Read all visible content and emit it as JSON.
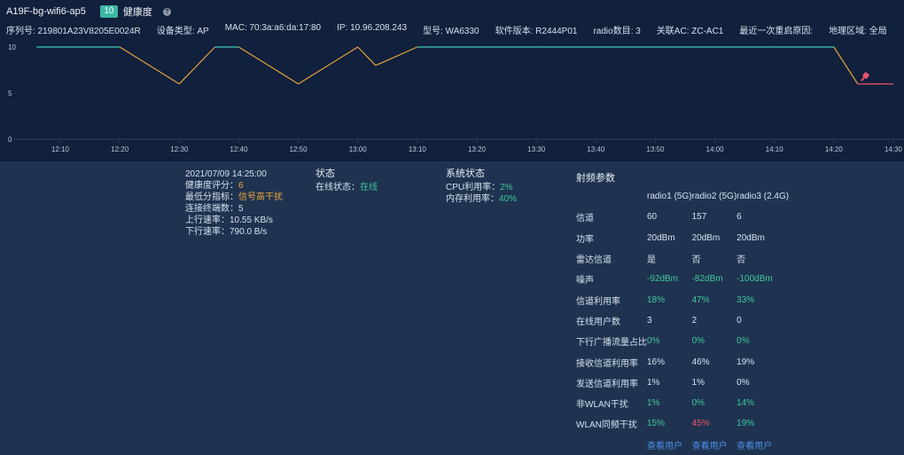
{
  "header": {
    "device_name": "A19F-bg-wifi6-ap5",
    "health_score": "10",
    "health_label": "健康度",
    "help_glyph": "?"
  },
  "meta": [
    "序列号: 219801A23V8205E0024R",
    "设备类型: AP",
    "MAC: 70:3a:a6:da:17:80",
    "IP: 10.96.208.243",
    "型号: WA6330",
    "软件版本: R2444P01",
    "radio数目: 3",
    "关联AC: ZC-AC1",
    "最近一次重启原因:",
    "地理区域: 全局"
  ],
  "chart_data": {
    "type": "line",
    "x": [
      "12:06",
      "12:10",
      "12:20",
      "12:30",
      "12:36",
      "12:40",
      "12:50",
      "13:00",
      "13:03",
      "13:10",
      "13:20",
      "13:30",
      "13:40",
      "13:50",
      "14:00",
      "14:10",
      "14:20",
      "14:24",
      "14:25",
      "14:30"
    ],
    "xticks": [
      "12:10",
      "12:20",
      "12:30",
      "12:40",
      "12:50",
      "13:00",
      "13:10",
      "13:20",
      "13:30",
      "13:40",
      "13:50",
      "14:00",
      "14:10",
      "14:20",
      "14:30"
    ],
    "yticks": [
      "0",
      "5",
      "10"
    ],
    "ylim": [
      0,
      10
    ],
    "series": [
      {
        "values": [
          10,
          10,
          10,
          6,
          10,
          10,
          6,
          10,
          8,
          10,
          10,
          10,
          10,
          10,
          10,
          10,
          10,
          6,
          6,
          6
        ]
      }
    ],
    "colors": {
      "good": "#3ec8c0",
      "warn": "#e8a23a",
      "bad": "#e8506a"
    },
    "grid": false
  },
  "detail": {
    "time": "2021/07/09 14:25:00",
    "score_label": "健康度评分：",
    "score_value": "6",
    "min_label": "最低分指标：",
    "min_value": "信号高干扰",
    "clients": "连接终端数：5",
    "up": "上行速率：10.55 KB/s",
    "down": "下行速率：790.0 B/s"
  },
  "status": {
    "title": "状态",
    "online_label": "在线状态：",
    "online_value": "在线"
  },
  "system": {
    "title": "系统状态",
    "cpu_label": "CPU利用率：",
    "cpu_value": "2%",
    "mem_label": "内存利用率：",
    "mem_value": "40%"
  },
  "radio": {
    "title": "射频参数",
    "headers": [
      "",
      "radio1 (5G)",
      "radio2 (5G)",
      "radio3 (2.4G)"
    ],
    "rows": [
      {
        "label": "信道",
        "values": [
          "60",
          "157",
          "6"
        ],
        "cls": [
          "",
          "",
          ""
        ]
      },
      {
        "label": "功率",
        "values": [
          "20dBm",
          "20dBm",
          "20dBm"
        ],
        "cls": [
          "",
          "",
          ""
        ]
      },
      {
        "label": "雷达信道",
        "values": [
          "是",
          "否",
          "否"
        ],
        "cls": [
          "",
          "",
          ""
        ]
      },
      {
        "label": "噪声",
        "values": [
          "-92dBm",
          "-82dBm",
          "-100dBm"
        ],
        "cls": [
          "green",
          "green",
          "green"
        ]
      },
      {
        "label": "信道利用率",
        "values": [
          "18%",
          "47%",
          "33%"
        ],
        "cls": [
          "green",
          "green",
          "green"
        ]
      },
      {
        "label": "在线用户数",
        "values": [
          "3",
          "2",
          "0"
        ],
        "cls": [
          "",
          "",
          ""
        ]
      },
      {
        "label": "下行广播流量占比",
        "values": [
          "0%",
          "0%",
          "0%"
        ],
        "cls": [
          "green",
          "green",
          "green"
        ]
      },
      {
        "label": "接收信道利用率",
        "values": [
          "16%",
          "46%",
          "19%"
        ],
        "cls": [
          "",
          "",
          ""
        ]
      },
      {
        "label": "发送信道利用率",
        "values": [
          "1%",
          "1%",
          "0%"
        ],
        "cls": [
          "",
          "",
          ""
        ]
      },
      {
        "label": "非WLAN干扰",
        "values": [
          "1%",
          "0%",
          "14%"
        ],
        "cls": [
          "green",
          "green",
          "green"
        ]
      },
      {
        "label": "WLAN同频干扰",
        "values": [
          "15%",
          "45%",
          "19%"
        ],
        "cls": [
          "green",
          "red",
          "green"
        ]
      }
    ],
    "links": [
      "查看用户",
      "查看用户",
      "查看用户"
    ]
  }
}
